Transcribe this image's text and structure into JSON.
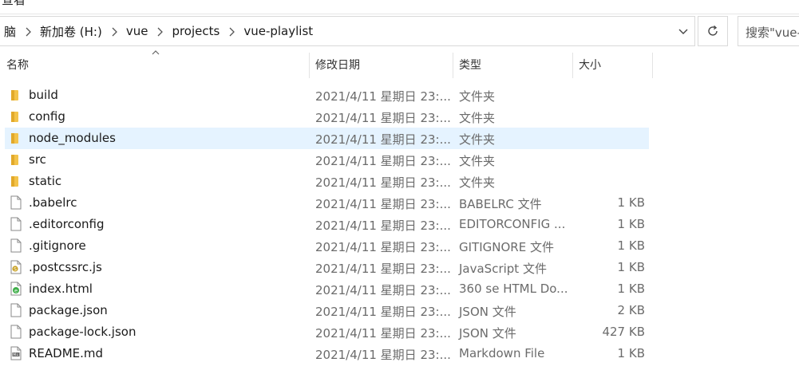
{
  "window": {
    "title_fragment": "查看"
  },
  "address": {
    "crumbs": [
      "脑",
      "新加卷 (H:)",
      "vue",
      "projects",
      "vue-playlist"
    ]
  },
  "search": {
    "placeholder": "搜索\"vue-"
  },
  "columns": {
    "name": "名称",
    "date": "修改日期",
    "type": "类型",
    "size": "大小"
  },
  "files": [
    {
      "name": "build",
      "date": "2021/4/11 星期日 23:...",
      "type": "文件夹",
      "size": "",
      "icon": "folder-icon",
      "selected": false
    },
    {
      "name": "config",
      "date": "2021/4/11 星期日 23:...",
      "type": "文件夹",
      "size": "",
      "icon": "folder-icon",
      "selected": false
    },
    {
      "name": "node_modules",
      "date": "2021/4/11 星期日 23:...",
      "type": "文件夹",
      "size": "",
      "icon": "folder-icon",
      "selected": true
    },
    {
      "name": "src",
      "date": "2021/4/11 星期日 23:...",
      "type": "文件夹",
      "size": "",
      "icon": "folder-icon",
      "selected": false
    },
    {
      "name": "static",
      "date": "2021/4/11 星期日 23:...",
      "type": "文件夹",
      "size": "",
      "icon": "folder-icon",
      "selected": false
    },
    {
      "name": ".babelrc",
      "date": "2021/4/11 星期日 23:...",
      "type": "BABELRC 文件",
      "size": "1 KB",
      "icon": "file-icon",
      "selected": false
    },
    {
      "name": ".editorconfig",
      "date": "2021/4/11 星期日 23:...",
      "type": "EDITORCONFIG ...",
      "size": "1 KB",
      "icon": "file-icon",
      "selected": false
    },
    {
      "name": ".gitignore",
      "date": "2021/4/11 星期日 23:...",
      "type": "GITIGNORE 文件",
      "size": "1 KB",
      "icon": "file-icon",
      "selected": false
    },
    {
      "name": ".postcssrc.js",
      "date": "2021/4/11 星期日 23:...",
      "type": "JavaScript 文件",
      "size": "1 KB",
      "icon": "js-file-icon",
      "selected": false
    },
    {
      "name": "index.html",
      "date": "2021/4/11 星期日 23:...",
      "type": "360 se HTML Do...",
      "size": "1 KB",
      "icon": "html-file-icon",
      "selected": false
    },
    {
      "name": "package.json",
      "date": "2021/4/11 星期日 23:...",
      "type": "JSON 文件",
      "size": "2 KB",
      "icon": "file-icon",
      "selected": false
    },
    {
      "name": "package-lock.json",
      "date": "2021/4/11 星期日 23:...",
      "type": "JSON 文件",
      "size": "427 KB",
      "icon": "file-icon",
      "selected": false
    },
    {
      "name": "README.md",
      "date": "2021/4/11 星期日 23:...",
      "type": "Markdown File",
      "size": "1 KB",
      "icon": "markdown-file-icon",
      "selected": false
    }
  ],
  "colors": {
    "selection": "#e5f3ff",
    "folder": "#f3c34a",
    "muted_text": "#6b6b6b"
  }
}
